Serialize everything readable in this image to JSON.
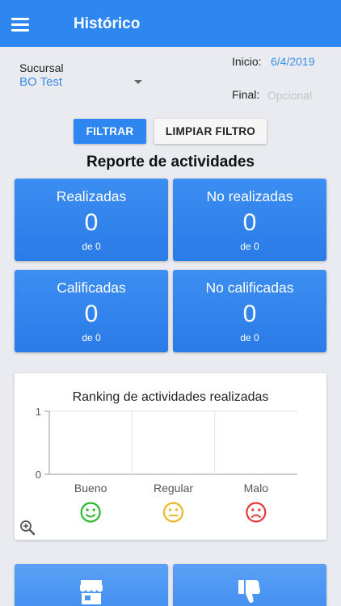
{
  "app_bar": {
    "title": "Histórico",
    "menu_icon": "hamburger-menu-icon"
  },
  "filters": {
    "branch_label": "Sucursal",
    "branch_value": "BO Test",
    "start_label": "Inicio:",
    "start_value": "6/4/2019",
    "end_label": "Final:",
    "end_placeholder": "Opcional"
  },
  "actions": {
    "filter_label": "FILTRAR",
    "clear_label": "LIMPIAR FILTRO"
  },
  "report": {
    "title": "Reporte de actividades",
    "cards": [
      {
        "title": "Realizadas",
        "value": "0",
        "sub": "de 0"
      },
      {
        "title": "No realizadas",
        "value": "0",
        "sub": "de 0"
      },
      {
        "title": "Calificadas",
        "value": "0",
        "sub": "de 0"
      },
      {
        "title": "No calificadas",
        "value": "0",
        "sub": "de 0"
      }
    ],
    "accent_color": "#2e86f0"
  },
  "chart_data": {
    "type": "bar",
    "title": "Ranking de actividades realizadas",
    "categories": [
      "Bueno",
      "Regular",
      "Malo"
    ],
    "values": [
      0,
      0,
      0
    ],
    "y_ticks": [
      "0",
      "1"
    ],
    "ylim": [
      0,
      1
    ],
    "grid": true,
    "category_icons": [
      "smile-face-icon",
      "neutral-face-icon",
      "sad-face-icon"
    ],
    "category_colors": [
      "#2ab72a",
      "#e8b72a",
      "#e53935"
    ]
  },
  "zoom_icon": "zoom-in-icon",
  "bottom_cards": [
    {
      "icon": "store-icon"
    },
    {
      "icon": "thumbs-down-icon"
    }
  ]
}
